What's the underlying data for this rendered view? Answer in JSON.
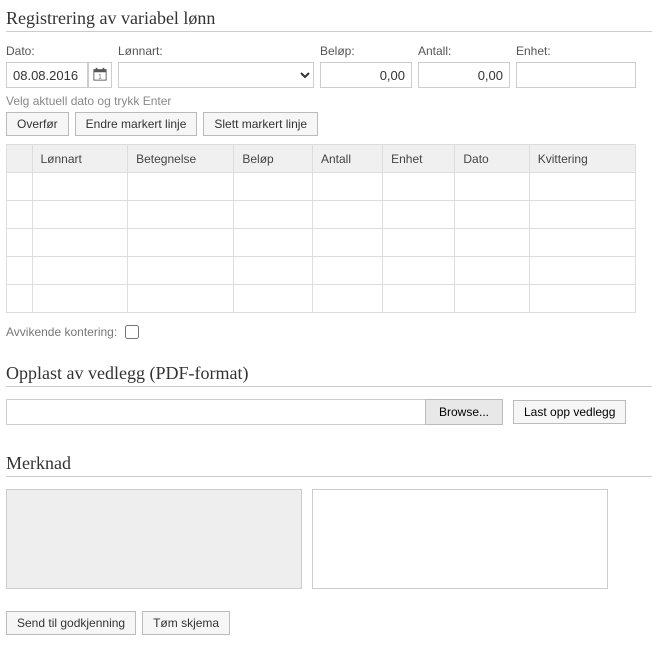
{
  "section1": {
    "title": "Registrering av variabel lønn",
    "labels": {
      "dato": "Dato:",
      "lonnart": "Lønnart:",
      "belop": "Beløp:",
      "antall": "Antall:",
      "enhet": "Enhet:"
    },
    "values": {
      "dato": "08.08.2016",
      "belop": "0,00",
      "antall": "0,00",
      "enhet": ""
    },
    "hint": "Velg aktuell dato og trykk Enter",
    "buttons": {
      "overfor": "Overfør",
      "endre": "Endre markert linje",
      "slett": "Slett markert linje"
    },
    "grid": {
      "headers": [
        "Lønnart",
        "Betegnelse",
        "Beløp",
        "Antall",
        "Enhet",
        "Dato",
        "Kvittering"
      ],
      "rowCount": 5
    },
    "avvikende_label": "Avvikende kontering:"
  },
  "section2": {
    "title": "Opplast av vedlegg (PDF-format)",
    "browse": "Browse...",
    "upload": "Last opp vedlegg"
  },
  "section3": {
    "title": "Merknad"
  },
  "footer": {
    "send": "Send til godkjenning",
    "tom": "Tøm skjema"
  }
}
